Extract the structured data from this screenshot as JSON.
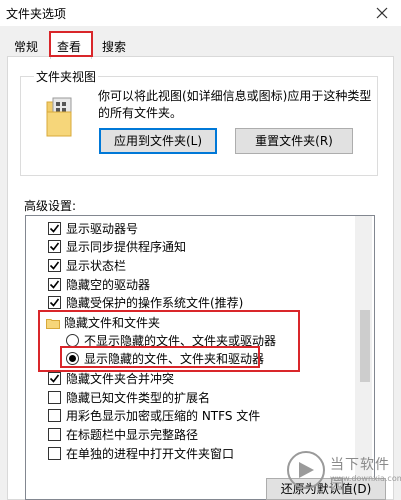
{
  "window": {
    "title": "文件夹选项"
  },
  "tabs": [
    {
      "label": "常规",
      "active": false
    },
    {
      "label": "查看",
      "active": true
    },
    {
      "label": "搜索",
      "active": false
    }
  ],
  "folder_views": {
    "group_label": "文件夹视图",
    "description": "你可以将此视图(如详细信息或图标)应用于这种类型的所有文件夹。",
    "apply_button": "应用到文件夹(L)",
    "reset_button": "重置文件夹(R)"
  },
  "advanced": {
    "label": "高级设置:",
    "items": [
      {
        "type": "checkbox",
        "label": "显示驱动器号",
        "checked": true
      },
      {
        "type": "checkbox",
        "label": "显示同步提供程序通知",
        "checked": true
      },
      {
        "type": "checkbox",
        "label": "显示状态栏",
        "checked": true
      },
      {
        "type": "checkbox",
        "label": "隐藏空的驱动器",
        "checked": true
      },
      {
        "type": "checkbox",
        "label": "隐藏受保护的操作系统文件(推荐)",
        "checked": true
      },
      {
        "type": "folder",
        "label": "隐藏文件和文件夹"
      },
      {
        "type": "radio",
        "label": "不显示隐藏的文件、文件夹或驱动器",
        "checked": false
      },
      {
        "type": "radio",
        "label": "显示隐藏的文件、文件夹和驱动器",
        "checked": true
      },
      {
        "type": "checkbox",
        "label": "隐藏文件夹合并冲突",
        "checked": true
      },
      {
        "type": "checkbox",
        "label": "隐藏已知文件类型的扩展名",
        "checked": false
      },
      {
        "type": "checkbox",
        "label": "用彩色显示加密或压缩的 NTFS 文件",
        "checked": false
      },
      {
        "type": "checkbox",
        "label": "在标题栏中显示完整路径",
        "checked": false
      },
      {
        "type": "checkbox",
        "label": "在单独的进程中打开文件夹窗口",
        "checked": false
      }
    ]
  },
  "restore_button": "还原为默认值(D)",
  "watermark": {
    "name": "当下软件园",
    "url": "www.downxia.com"
  },
  "colors": {
    "highlight": "#d9262a",
    "accent": "#0078d7"
  }
}
